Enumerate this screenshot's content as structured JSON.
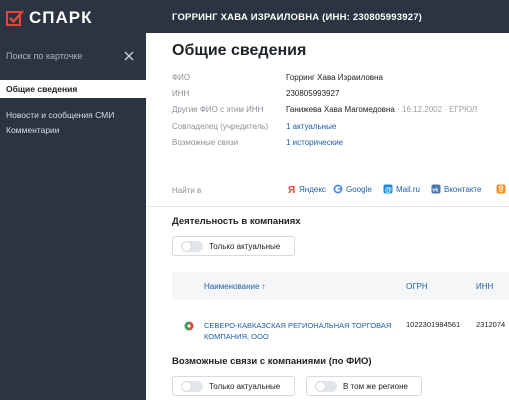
{
  "app": {
    "logo_text": "СПАРК",
    "brand_color": "#e8443a"
  },
  "sidebar": {
    "search": {
      "placeholder": "Поиск по карточке"
    },
    "items": [
      {
        "label": "Общие сведения",
        "active": true
      },
      {
        "label": "Новости и сообщения СМИ"
      },
      {
        "label": "Комментарии"
      }
    ]
  },
  "header": {
    "title": "ГОРРИНГ ХАВА ИЗРАИЛОВНА (ИНН: 230805993927)"
  },
  "page": {
    "title": "Общие сведения"
  },
  "info": {
    "fio_label": "ФИО",
    "fio_value": "Горринг Хава Израиловна",
    "inn_label": "ИНН",
    "inn_value": "230805993927",
    "other_fio_label": "Другие ФИО с этим ИНН",
    "other_fio_value": "Ганижева Хава Магомедовна",
    "other_fio_meta": "· 16.12.2002 · ЕГРЮЛ",
    "owner_label": "Совладелец (учредитель)",
    "owner_value": "1 актуальные",
    "links_label": "Возможные связи",
    "links_value": "1 исторические"
  },
  "find_in": {
    "label": "Найти в",
    "engines": [
      {
        "name": "Яндекс",
        "icon": "yandex-icon",
        "color": "#e8443a"
      },
      {
        "name": "Google",
        "icon": "google-icon",
        "color": "#4285f4"
      },
      {
        "name": "Mail.ru",
        "icon": "mailru-icon",
        "color": "#168de2"
      },
      {
        "name": "Вконтакте",
        "icon": "vk-icon",
        "color": "#4a76a8"
      }
    ]
  },
  "activity": {
    "title": "Деятельность в компаниях",
    "toggle_label": "Только актуальные",
    "columns": {
      "name": "Наименование ↑",
      "ogrn": "ОГРН",
      "inn": "ИНН"
    },
    "rows": [
      {
        "name": "СЕВЕРО-КАВКАЗСКАЯ РЕГИОНАЛЬНАЯ ТОРГОВАЯ КОМПАНИЯ, ООО",
        "ogrn": "1022301984561",
        "inn": "2312074"
      }
    ]
  },
  "possible_links": {
    "title": "Возможные связи с компаниями (по ФИО)",
    "toggle_actual": "Только актуальные",
    "toggle_region": "В том же регионе"
  }
}
